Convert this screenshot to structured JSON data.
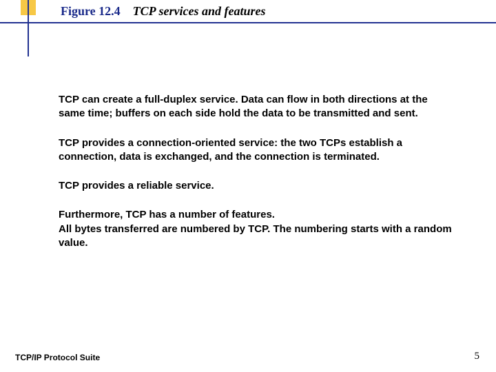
{
  "header": {
    "figure_label": "Figure 12.4",
    "figure_title": "TCP services and features"
  },
  "body": {
    "p1": "TCP can create a full-duplex service.  Data can flow in both directions at the same time; buffers on each side hold the data to be transmitted and sent.",
    "p2": "TCP provides a connection-oriented service: the two TCPs establish a connection, data is exchanged, and the connection is terminated.",
    "p3": "TCP provides a reliable service.",
    "p4": "Furthermore, TCP has a number of features.\nAll bytes transferred are numbered by TCP.  The numbering starts with a random value."
  },
  "footer": {
    "left": "TCP/IP Protocol Suite",
    "page_number": "5"
  }
}
